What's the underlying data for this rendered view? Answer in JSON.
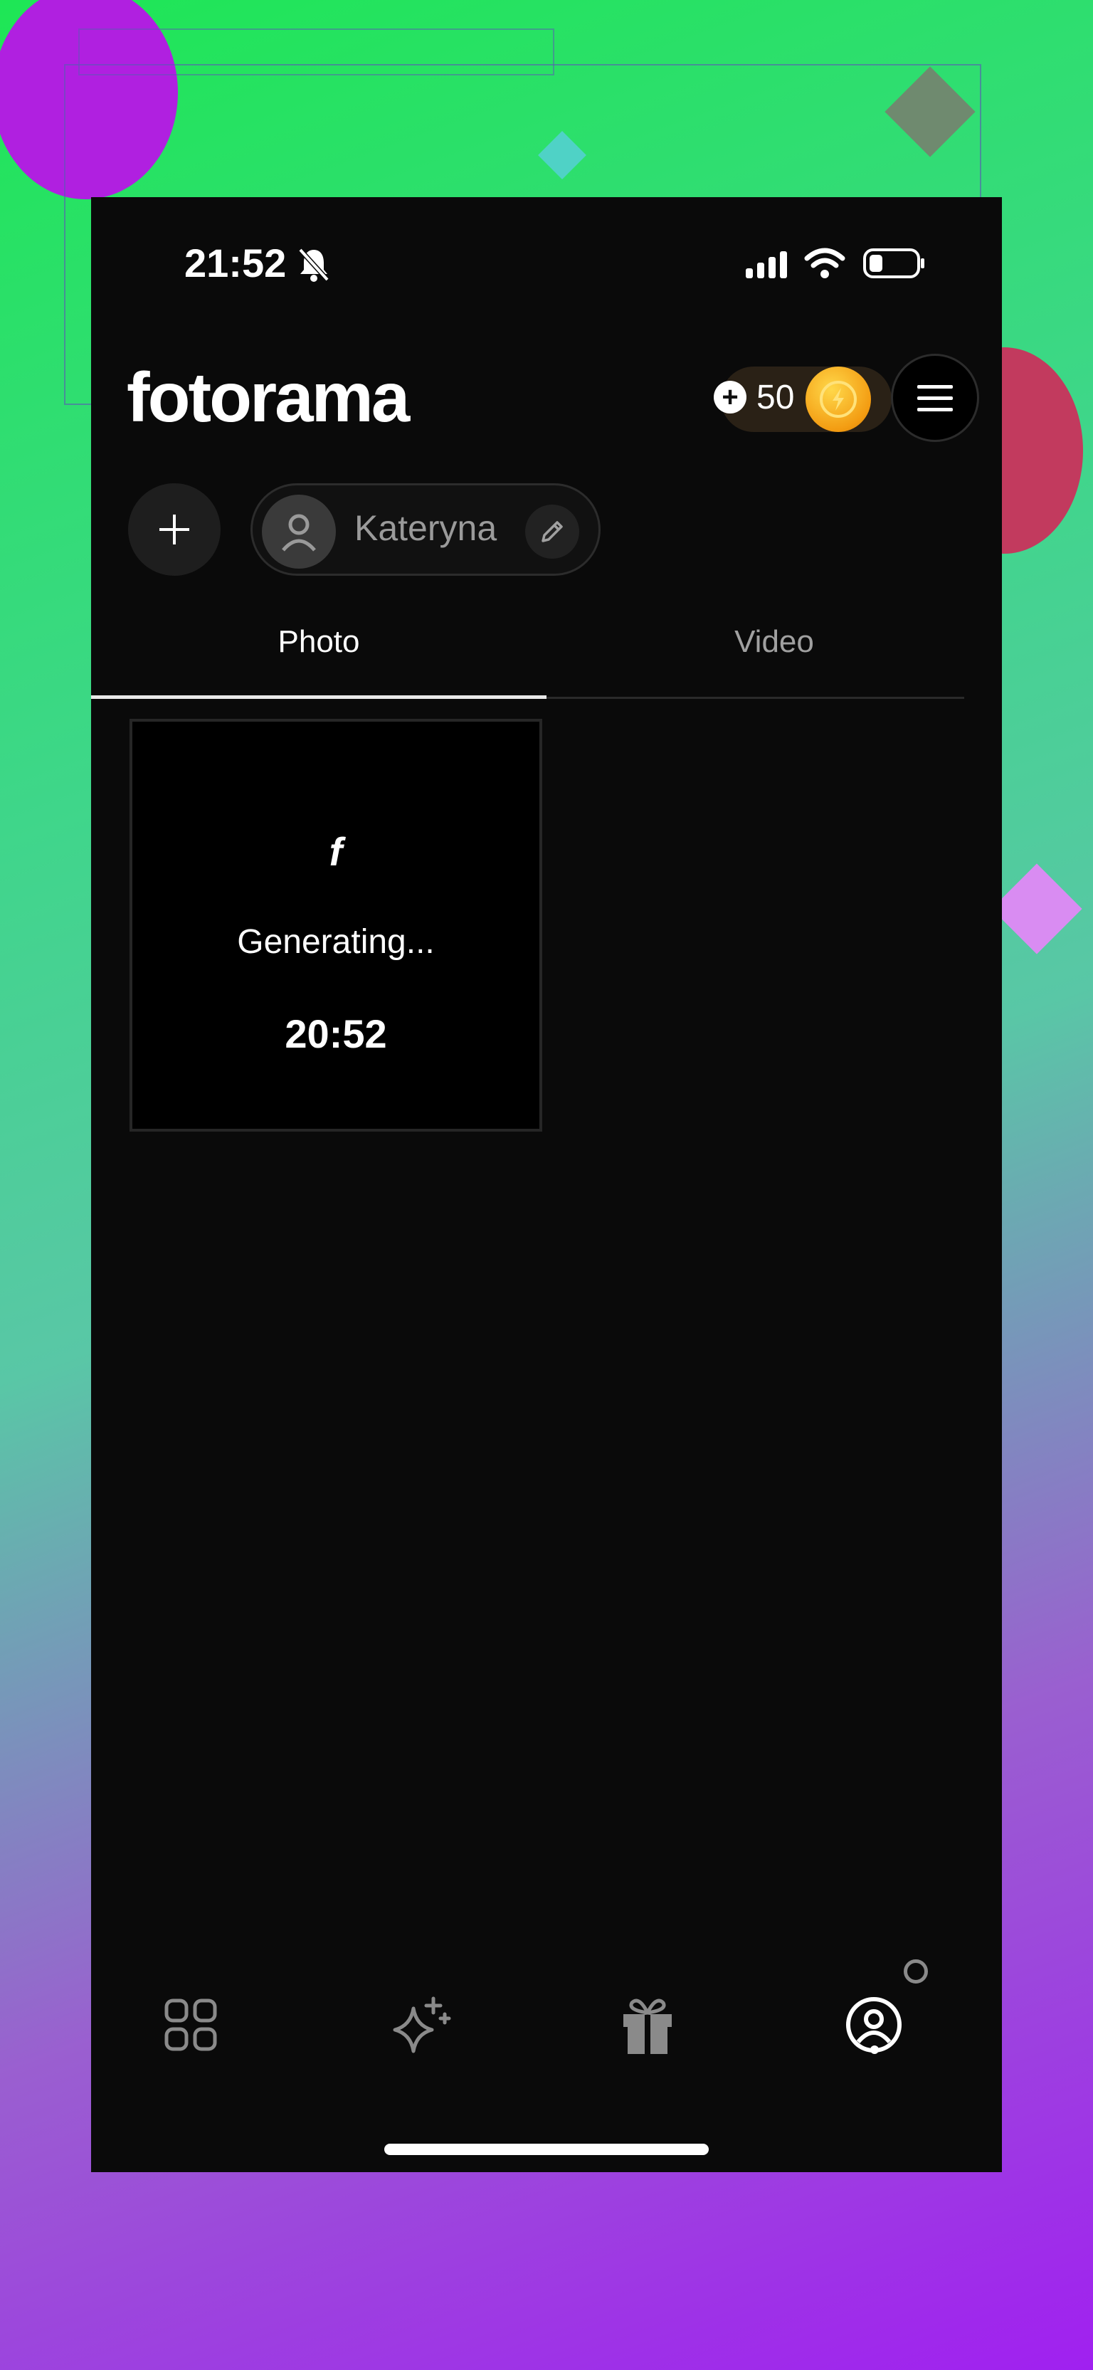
{
  "status_bar": {
    "time": "21:52"
  },
  "header": {
    "logo_text": "fotorama",
    "coin_count": "50"
  },
  "profile": {
    "name": "Kateryna"
  },
  "tabs": [
    {
      "label": "Photo",
      "active": true
    },
    {
      "label": "Video",
      "active": false
    }
  ],
  "generation_card": {
    "status": "Generating...",
    "time": "20:52",
    "glyph": "f"
  },
  "bottom_nav": [
    {
      "icon": "grid-icon",
      "active": false
    },
    {
      "icon": "sparkle-icon",
      "active": false
    },
    {
      "icon": "gift-icon",
      "active": false
    },
    {
      "icon": "profile-icon",
      "active": true
    }
  ],
  "colors": {
    "background": "#0a0a0a",
    "coin": "#f39c12",
    "active_tab": "#ffffff",
    "inactive_tab": "#a0a0a0"
  }
}
